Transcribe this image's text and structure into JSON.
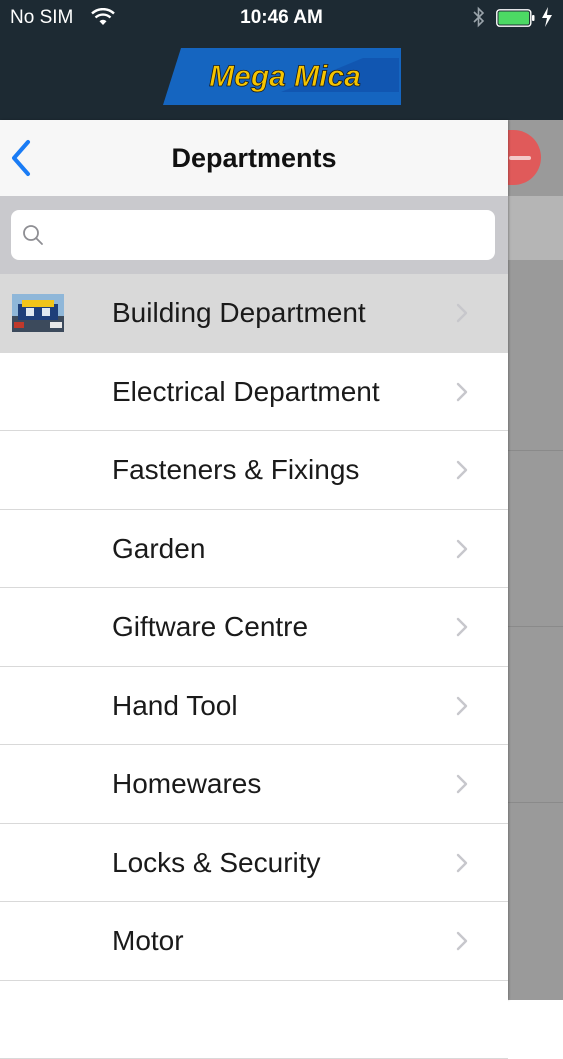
{
  "status_bar": {
    "carrier": "No SIM",
    "time": "10:46 AM",
    "battery_level": 0.95,
    "battery_color": "#4cd964"
  },
  "header": {
    "logo_text": "Mega Mica",
    "background_color": "#1d2a33",
    "logo_colors": {
      "background": "#1565c0",
      "text": "#f5c400"
    }
  },
  "drawer": {
    "title": "Departments",
    "back_icon": "chevron-left-icon",
    "accent_color": "#1a7cf5",
    "search": {
      "placeholder": "",
      "value": ""
    },
    "items": [
      {
        "label": "Building Department",
        "selected": true,
        "has_thumbnail": true
      },
      {
        "label": "Electrical Department",
        "selected": false
      },
      {
        "label": "Fasteners & Fixings",
        "selected": false
      },
      {
        "label": "Garden",
        "selected": false
      },
      {
        "label": "Giftware Centre",
        "selected": false
      },
      {
        "label": "Hand Tool",
        "selected": false
      },
      {
        "label": "Homewares",
        "selected": false
      },
      {
        "label": "Locks & Security",
        "selected": false
      },
      {
        "label": "Motor",
        "selected": false
      }
    ]
  },
  "close_button": {
    "icon": "minus-icon",
    "color": "#e05a5a"
  }
}
